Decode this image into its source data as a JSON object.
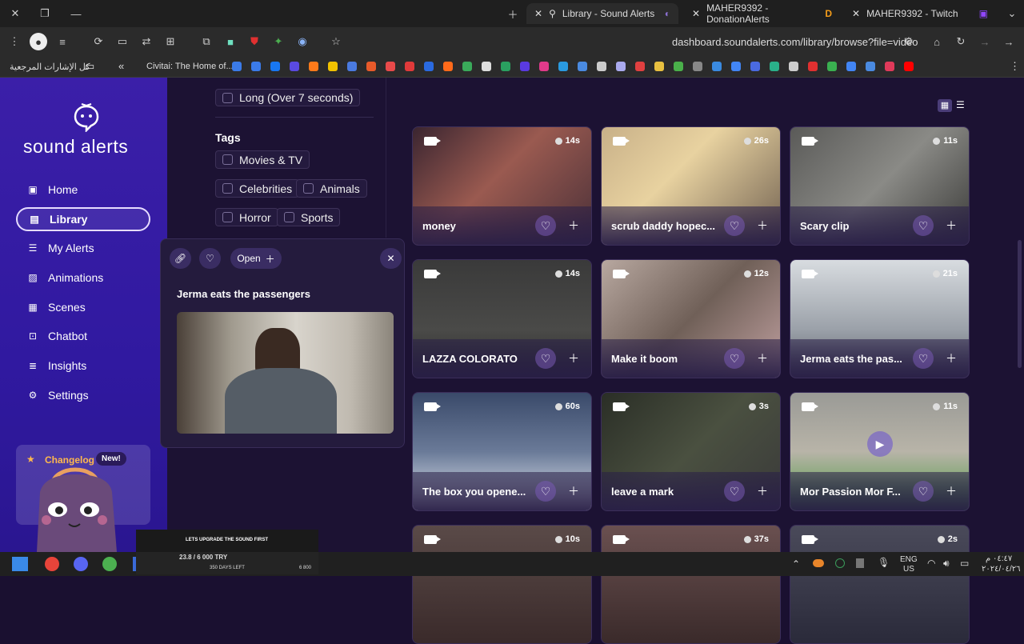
{
  "browser": {
    "tabs": [
      {
        "title": "Library - Sound Alerts",
        "active": true
      },
      {
        "title": "MAHER9392 - DonationAlerts",
        "active": false
      },
      {
        "title": "MAHER9392 - Twitch",
        "active": false
      }
    ],
    "url": "dashboard.soundalerts.com/library/browse?file=video",
    "bookmarks_folder": "كل الإشارات المرجعية",
    "bookmark_civitai": "Civitai: The Home of..."
  },
  "sidebar": {
    "brand": "sound alerts",
    "items": [
      {
        "label": "Home",
        "icon": "home-icon"
      },
      {
        "label": "Library",
        "icon": "library-icon",
        "active": true
      },
      {
        "label": "My Alerts",
        "icon": "list-icon"
      },
      {
        "label": "Animations",
        "icon": "image-icon"
      },
      {
        "label": "Scenes",
        "icon": "grid-icon"
      },
      {
        "label": "Chatbot",
        "icon": "robot-icon"
      },
      {
        "label": "Insights",
        "icon": "chart-icon"
      },
      {
        "label": "Settings",
        "icon": "gear-icon"
      }
    ],
    "changelog": {
      "label": "Changelog",
      "badge": "New!"
    }
  },
  "filters": {
    "duration_option": "Long (Over 7 seconds)",
    "tags_heading": "Tags",
    "tags": [
      "Movies & TV",
      "Celebrities",
      "Animals",
      "Horror",
      "Sports"
    ]
  },
  "popup": {
    "title": "Jerma eats the passengers",
    "open_label": "Open"
  },
  "cards": [
    {
      "title": "money",
      "duration": "14s"
    },
    {
      "title": "scrub daddy hopec...",
      "duration": "26s"
    },
    {
      "title": "Scary clip",
      "duration": "11s"
    },
    {
      "title": "LAZZA COLORATO",
      "duration": "14s"
    },
    {
      "title": "Make it boom",
      "duration": "12s"
    },
    {
      "title": "Jerma eats the pas...",
      "duration": "21s"
    },
    {
      "title": "The box you opene...",
      "duration": "60s"
    },
    {
      "title": "leave a mark",
      "duration": "3s"
    },
    {
      "title": "Mor Passion Mor F...",
      "duration": "11s"
    },
    {
      "title": "",
      "duration": "10s"
    },
    {
      "title": "",
      "duration": "37s"
    },
    {
      "title": "",
      "duration": "2s"
    }
  ],
  "overlay": {
    "upgrade_text": "LETS UPGRADE THE SOUND FIRST",
    "progress_text": "23.8 / 6 000 TRY",
    "days_left": "350 DAYS LEFT",
    "goal": "6 800"
  },
  "taskbar": {
    "lang": "ENG",
    "region": "US",
    "time": "٠٤:٤٧ م",
    "date": "٢٠٢٤/٠٤/٢٦"
  },
  "colors": {
    "accent": "#3b1fa8",
    "bg": "#1c1233",
    "changelog": "#ffb84d"
  }
}
